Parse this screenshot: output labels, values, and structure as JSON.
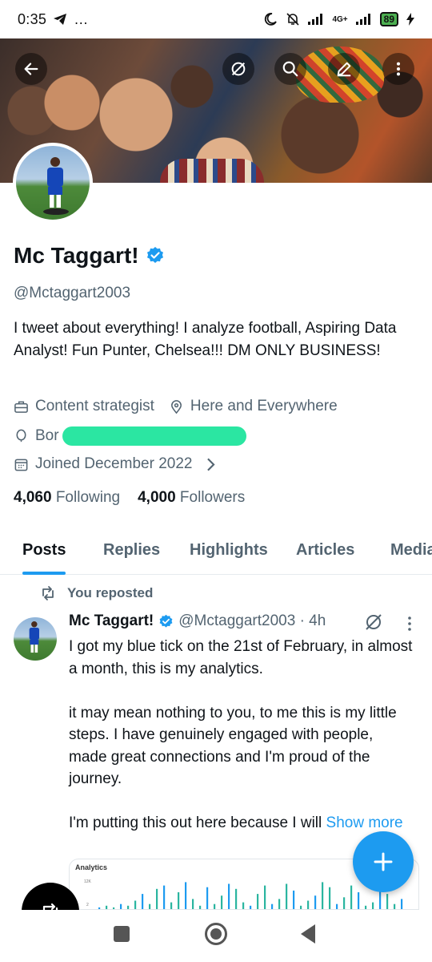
{
  "status_bar": {
    "time": "0:35",
    "extras": "…",
    "network": "4G+",
    "battery": "89"
  },
  "profile": {
    "name": "Mc Taggart!",
    "handle": "@Mctaggart2003",
    "bio": "I tweet about everything! I analyze football,  Aspiring Data Analyst!  Fun Punter, Chelsea!!!  DM ONLY BUSINESS!",
    "category": "Content strategist",
    "location": "Here and Everywhere",
    "born_prefix": "Bor",
    "joined": "Joined December 2022",
    "following_count": "4,060",
    "following_label": "Following",
    "followers_count": "4,000",
    "followers_label": "Followers"
  },
  "tabs": [
    {
      "label": "Posts",
      "active": true
    },
    {
      "label": "Replies",
      "active": false
    },
    {
      "label": "Highlights",
      "active": false
    },
    {
      "label": "Articles",
      "active": false
    },
    {
      "label": "Media",
      "active": false
    }
  ],
  "post": {
    "repost_label": "You reposted",
    "author_name": "Mc Taggart!",
    "author_meta": "@Mctaggart2003 · 4h",
    "text": "I got my blue tick on the 21st of February, in almost a month, this is my analytics.\n\nit may mean nothing to you, to me this is my little steps. I have genuinely engaged with people, made great connections and I'm proud of the journey.\n\nI'm putting this out here because I will ",
    "show_more": "Show more",
    "image_title": "Analytics",
    "image_axis_top": "12K",
    "image_axis_mid": "2"
  },
  "colors": {
    "accent": "#1d9bf0",
    "text_primary": "#0f1419",
    "text_secondary": "#536471",
    "redaction": "#2be6a2"
  },
  "icons": {
    "back": "arrow-left-icon",
    "grok": "grok-icon",
    "search": "search-icon",
    "edit": "pencil-icon",
    "more": "more-vertical-icon",
    "verified": "verified-badge-icon",
    "briefcase": "briefcase-icon",
    "location": "location-pin-icon",
    "birthday": "balloon-icon",
    "calendar": "calendar-icon",
    "repost": "repost-icon",
    "compose": "plus-icon"
  }
}
